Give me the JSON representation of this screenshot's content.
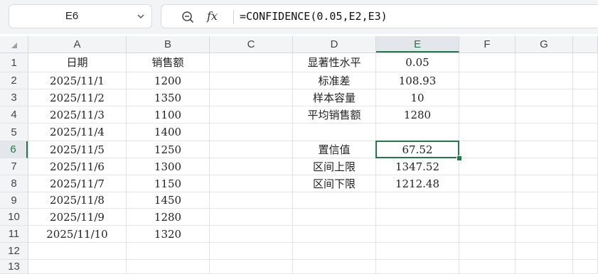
{
  "name_box": {
    "value": "E6"
  },
  "formula_bar": {
    "zoom_icon": "zoom-formula-icon",
    "fx_label": "fx",
    "formula": "=CONFIDENCE(0.05,E2,E3)"
  },
  "columns": [
    "A",
    "B",
    "C",
    "D",
    "E",
    "F",
    "G"
  ],
  "rows": [
    "1",
    "2",
    "3",
    "4",
    "5",
    "6",
    "7",
    "8",
    "9",
    "10",
    "11",
    "12",
    "13"
  ],
  "selected": {
    "column": "E",
    "row": "6"
  },
  "cells": {
    "A": [
      "日期",
      "2025/11/1",
      "2025/11/2",
      "2025/11/3",
      "2025/11/4",
      "2025/11/5",
      "2025/11/6",
      "2025/11/7",
      "2025/11/8",
      "2025/11/9",
      "2025/11/10",
      "",
      ""
    ],
    "B": [
      "销售额",
      "1200",
      "1350",
      "1100",
      "1400",
      "1250",
      "1300",
      "1150",
      "1450",
      "1280",
      "1320",
      "",
      ""
    ],
    "C": [
      "",
      "",
      "",
      "",
      "",
      "",
      "",
      "",
      "",
      "",
      "",
      "",
      ""
    ],
    "D": [
      "显著性水平",
      "标准差",
      "样本容量",
      "平均销售额",
      "",
      "置信值",
      "区间上限",
      "区间下限",
      "",
      "",
      "",
      "",
      ""
    ],
    "E": [
      "0.05",
      "108.93",
      "10",
      "1280",
      "",
      "67.52",
      "1347.52",
      "1212.48",
      "",
      "",
      "",
      "",
      ""
    ],
    "F": [
      "",
      "",
      "",
      "",
      "",
      "",
      "",
      "",
      "",
      "",
      "",
      "",
      ""
    ],
    "G": [
      "",
      "",
      "",
      "",
      "",
      "",
      "",
      "",
      "",
      "",
      "",
      "",
      ""
    ]
  },
  "colors": {
    "accent": "#1e7b45",
    "header_bg": "#f3f4f6",
    "gridline": "#e1e3e6"
  }
}
